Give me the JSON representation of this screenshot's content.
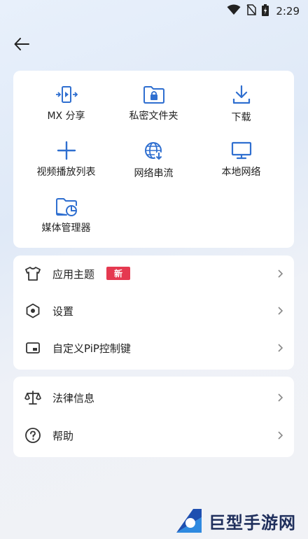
{
  "status_bar": {
    "time": "2:29",
    "icons": [
      "wifi-icon",
      "no-sim-icon",
      "battery-charging-icon"
    ]
  },
  "header": {
    "back_icon": "arrow-left-icon"
  },
  "grid": {
    "items": [
      {
        "label": "MX 分享",
        "icon": "share-transfer-icon"
      },
      {
        "label": "私密文件夹",
        "icon": "lock-folder-icon"
      },
      {
        "label": "下载",
        "icon": "download-icon"
      },
      {
        "label": "视频播放列表",
        "icon": "plus-icon"
      },
      {
        "label": "网络串流",
        "icon": "globe-download-icon"
      },
      {
        "label": "本地网络",
        "icon": "monitor-icon"
      },
      {
        "label": "媒体管理器",
        "icon": "folder-chart-icon"
      }
    ]
  },
  "settings_list": {
    "items": [
      {
        "label": "应用主题",
        "icon": "tshirt-icon",
        "badge": "新"
      },
      {
        "label": "设置",
        "icon": "hexagon-settings-icon"
      },
      {
        "label": "自定义PiP控制键",
        "icon": "pip-icon"
      }
    ]
  },
  "info_list": {
    "items": [
      {
        "label": "法律信息",
        "icon": "scale-icon"
      },
      {
        "label": "帮助",
        "icon": "help-circle-icon"
      }
    ]
  },
  "watermark": {
    "text": "巨型手游网"
  },
  "colors": {
    "accent_blue": "#2f6fd0",
    "badge_red": "#e53950",
    "icon_dark": "#333333"
  }
}
